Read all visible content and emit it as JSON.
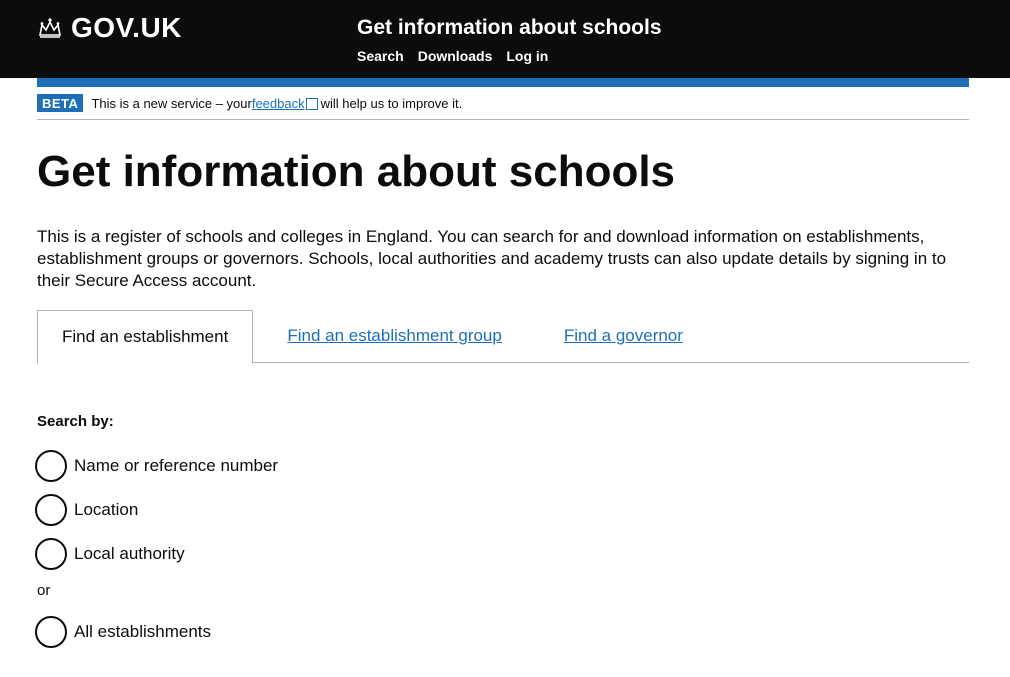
{
  "header": {
    "logo_text": "GOV.UK",
    "service_name": "Get information about schools",
    "nav": [
      "Search",
      "Downloads",
      "Log in"
    ]
  },
  "beta": {
    "tag": "BETA",
    "text_before": "This is a new service – your ",
    "link": "feedback",
    "text_after": " will help us to improve it."
  },
  "page": {
    "title": "Get information about schools",
    "intro": "This is a register of schools and colleges in England. You can search for and download information on establishments, establishment groups or governors. Schools, local authorities and academy trusts can also update details by signing in to their Secure Access account."
  },
  "tabs": [
    {
      "label": "Find an establishment",
      "selected": true
    },
    {
      "label": "Find an establishment group",
      "selected": false
    },
    {
      "label": "Find a governor",
      "selected": false
    }
  ],
  "search": {
    "label": "Search by:",
    "options": [
      "Name or reference number",
      "Location",
      "Local authority"
    ],
    "or_text": "or",
    "all_option": "All establishments"
  },
  "colors": {
    "brand_blue": "#1d70b8",
    "header_black": "#0b0c0c"
  }
}
